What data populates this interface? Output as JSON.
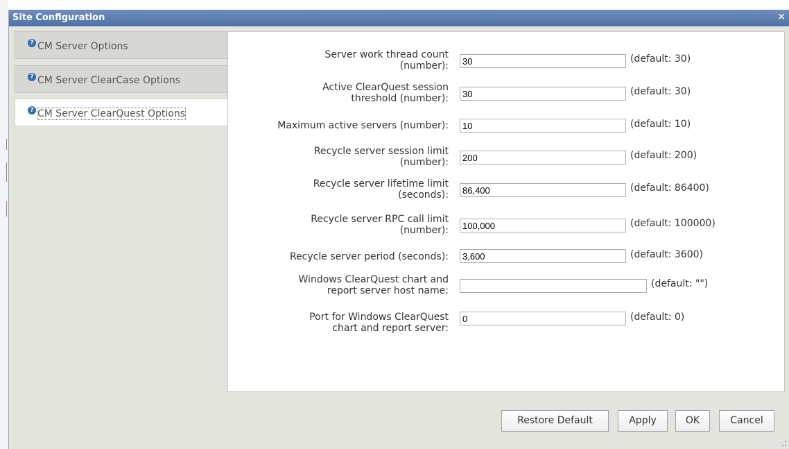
{
  "dialog": {
    "title": "Site Configuration"
  },
  "tabs": [
    {
      "label": "CM Server Options"
    },
    {
      "label": "CM Server ClearCase Options"
    },
    {
      "label": "CM Server ClearQuest Options"
    }
  ],
  "fields": [
    {
      "label_line1": "Server work thread count",
      "label_line2": "(number):",
      "value": "30",
      "default": "(default: 30)"
    },
    {
      "label_line1": "Active ClearQuest session",
      "label_line2": "threshold (number):",
      "value": "30",
      "default": "(default: 30)"
    },
    {
      "label_line1": "Maximum active servers (number):",
      "label_line2": "",
      "value": "10",
      "default": "(default: 10)"
    },
    {
      "label_line1": "Recycle server session limit",
      "label_line2": "(number):",
      "value": "200",
      "default": "(default: 200)"
    },
    {
      "label_line1": "Recycle server lifetime limit",
      "label_line2": "(seconds):",
      "value": "86,400",
      "default": "(default: 86400)"
    },
    {
      "label_line1": "Recycle server RPC call limit",
      "label_line2": "(number):",
      "value": "100,000",
      "default": "(default: 100000)"
    },
    {
      "label_line1": "Recycle server period (seconds):",
      "label_line2": "",
      "value": "3,600",
      "default": "(default: 3600)"
    },
    {
      "label_line1": "Windows ClearQuest chart and",
      "label_line2": "report server host name:",
      "value": "",
      "default": "(default: \"\")"
    },
    {
      "label_line1": "Port for Windows ClearQuest",
      "label_line2": "chart and report server:",
      "value": "0",
      "default": "(default: 0)"
    }
  ],
  "buttons": {
    "restore": "Restore Default",
    "apply": "Apply",
    "ok": "OK",
    "cancel": "Cancel"
  },
  "icons": {
    "help": "help-icon",
    "close": "close-icon"
  },
  "colors": {
    "titlebar": "#5577aa",
    "tab_inactive": "#d7d7d3",
    "tab_active": "#ffffff",
    "help_icon": "#2f6db0"
  }
}
